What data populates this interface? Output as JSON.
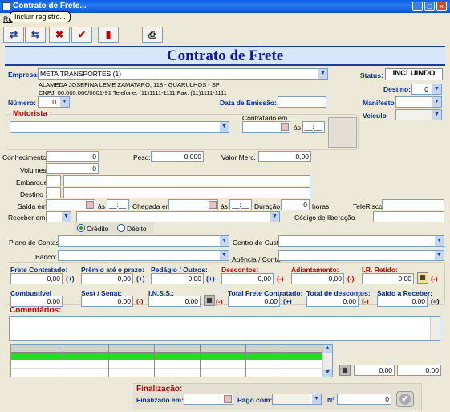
{
  "window": {
    "title": "Contrato de Frete..."
  },
  "menu": {
    "label": "Re"
  },
  "tooltip": "Incluir registro...",
  "toolbar": {
    "b1": "⇄",
    "b2": "⇆",
    "b3": "✖",
    "b4": "✔",
    "b5": "▮",
    "b6": "⎙"
  },
  "header": {
    "title": "Contrato de Frete"
  },
  "empresa": {
    "label": "Empresa:",
    "value": "META TRANSPORTES (1)",
    "address": "ALAMEDA JOSEFINA LEME ZAMATARO, 118 - GUARULHOS - SP",
    "info": "CNPJ: 00.000.000/0001-91 Telefone: (11)1111-1111 Fax: (11)1111-1111"
  },
  "status": {
    "label": "Status:",
    "value": "INCLUINDO"
  },
  "destino": {
    "label": "Destino:",
    "value": "0"
  },
  "numero": {
    "label": "Número:",
    "value": "0"
  },
  "emissao": {
    "label": "Data de Emissão:"
  },
  "manifesto": {
    "label": "Manifesto"
  },
  "veiculo": {
    "label": "Veículo"
  },
  "motorista": {
    "label": "Motorista",
    "contratado_em": "Contratado em",
    "as": "ás",
    "time": "__:__"
  },
  "fields": {
    "conhecimentos": {
      "label": "Conhecimentos:",
      "value": "0"
    },
    "peso": {
      "label": "Peso:",
      "value": "0,000"
    },
    "valor_merc": {
      "label": "Valor Merc.",
      "value": "0,00"
    },
    "volumes": {
      "label": "Volumes",
      "value": "0"
    },
    "embarque": {
      "label": "Embarque"
    },
    "destino2": {
      "label": "Destino"
    },
    "saida": {
      "label": "Saída em",
      "as": "ás",
      "time": "__:__"
    },
    "chegada": {
      "label": "Chegada em",
      "as": "ás",
      "time": "__:__"
    },
    "duracao": {
      "label": "Duração:",
      "value": "0",
      "unit": "horas"
    },
    "telerisco": {
      "label": "TeleRisco"
    },
    "receber": {
      "label": "Receber em"
    },
    "cod_lib": {
      "label": "Código de liberação"
    },
    "credito": "Crédito",
    "debito": "Débito",
    "plano": {
      "label": "Plano de Contas:"
    },
    "centro": {
      "label": "Centro de Custo"
    },
    "banco": {
      "label": "Banco:"
    },
    "agencia": {
      "label": "Agência / Conta"
    }
  },
  "values": {
    "frete": {
      "label": "Frete Contratado:",
      "value": "0,00",
      "op": "(+)"
    },
    "premio": {
      "label": "Prêmio até o prazo:",
      "value": "0,00",
      "op": "(+)"
    },
    "pedagio": {
      "label": "Pedágio / Outros:",
      "value": "0,00",
      "op": "(+)"
    },
    "descontos": {
      "label": "Descontos:",
      "value": "0,00",
      "op": "(-)"
    },
    "adiantamento": {
      "label": "Adiantamento:",
      "value": "0,00",
      "op": "(-)"
    },
    "ir": {
      "label": "I.R. Retido:",
      "value": "0,00",
      "op": "(-)"
    },
    "combustivel": {
      "label": "Combustível",
      "value": "0,00"
    },
    "sest": {
      "label": "Sest / Senat:",
      "value": "0,00",
      "op": "(-)"
    },
    "inss": {
      "label": "I.N.S.S.:",
      "value": "0,00",
      "op": "(-)"
    },
    "total_frete": {
      "label": "Total Frete Contratado:",
      "value": "0,00",
      "op": "(+)"
    },
    "total_desc": {
      "label": "Total de descontos:",
      "value": "0,00",
      "op": "(-)"
    },
    "saldo": {
      "label": "Saldo a Receber:",
      "value": "0,00",
      "op": "(=)"
    }
  },
  "comentarios": {
    "label": "Comentários:"
  },
  "totals": {
    "a": "0,00",
    "b": "0,00"
  },
  "finalizacao": {
    "title": "Finalização:",
    "finalizado": "Finalizado em:",
    "pago": "Pago com:",
    "n_label": "Nº",
    "n_value": "0"
  },
  "colors": {
    "accent": "#002d96",
    "title_blue": "#11179a",
    "red": "#c00000",
    "grid_green": "#22dd22"
  }
}
